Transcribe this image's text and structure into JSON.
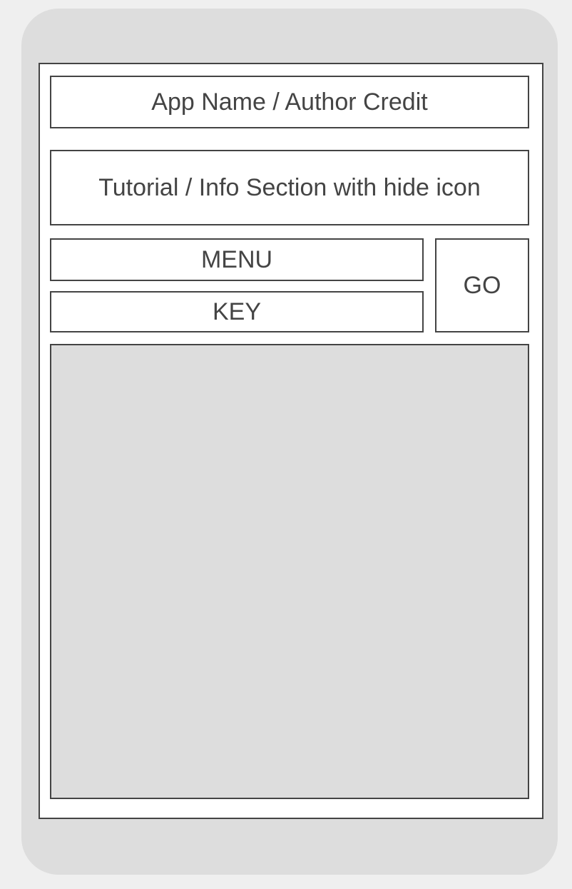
{
  "header": {
    "title": "App Name / Author Credit"
  },
  "info": {
    "text": "Tutorial / Info Section with hide icon"
  },
  "controls": {
    "menu_label": "MENU",
    "key_label": "KEY",
    "go_label": "GO"
  },
  "colors": {
    "page_background": "#efefef",
    "device_frame": "#dddddd",
    "screen_background": "#ffffff",
    "border": "#444444",
    "text": "#444444",
    "content_area": "#dddddd"
  }
}
